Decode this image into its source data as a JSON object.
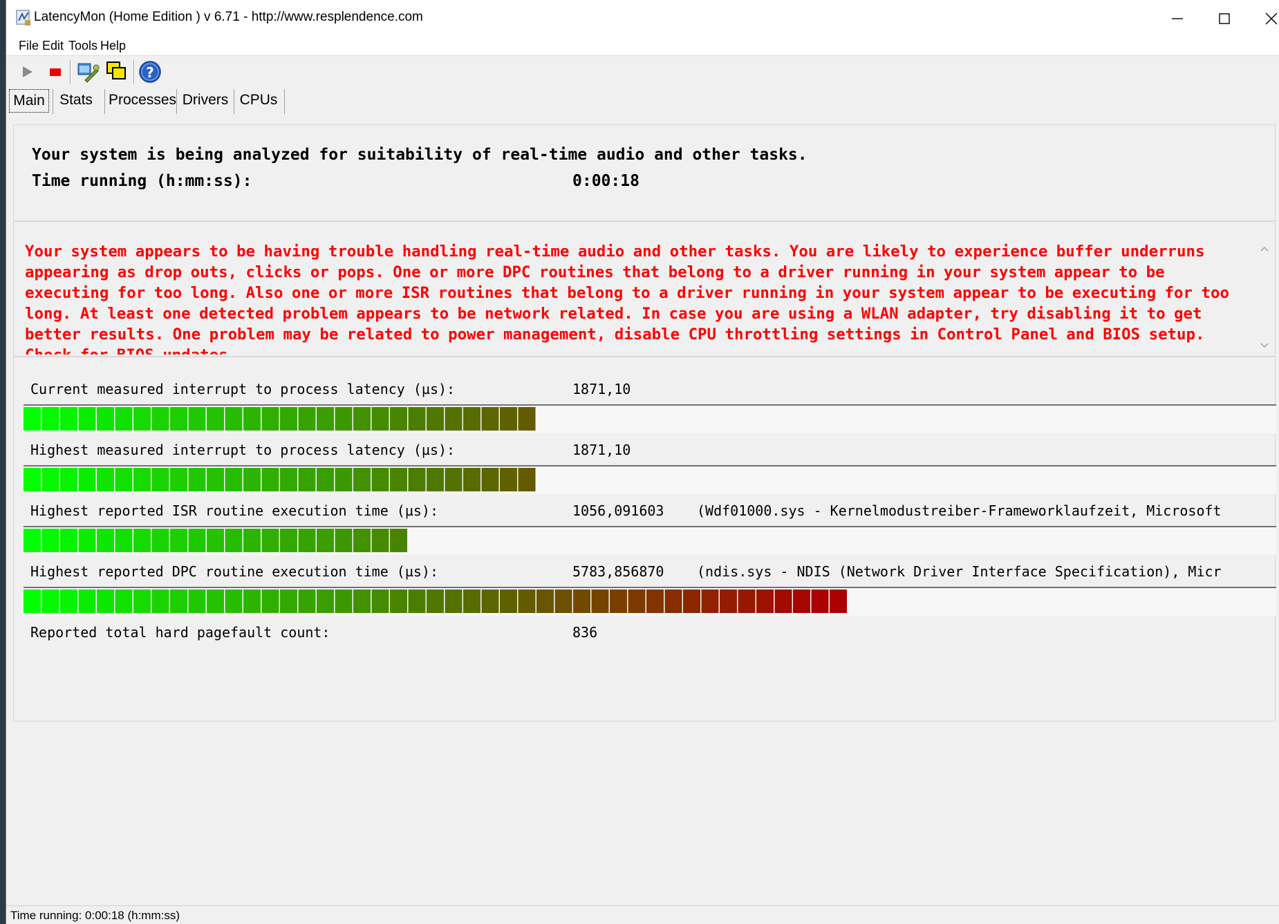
{
  "window": {
    "title": "LatencyMon  (Home Edition )  v 6.71 - http://www.resplendence.com"
  },
  "menu": {
    "items": [
      {
        "label": "File"
      },
      {
        "label": "Edit"
      },
      {
        "label": "Tools"
      },
      {
        "label": "Help"
      }
    ]
  },
  "toolbar": {
    "icons": [
      "play-icon",
      "stop-icon",
      "wrench-icon",
      "windows-icon",
      "help-icon"
    ]
  },
  "tabs": [
    {
      "label": "Main",
      "active": true
    },
    {
      "label": "Stats",
      "active": false
    },
    {
      "label": "Processes",
      "active": false
    },
    {
      "label": "Drivers",
      "active": false
    },
    {
      "label": "CPUs",
      "active": false
    }
  ],
  "summary": {
    "status_line": "Your system is being analyzed for suitability of real-time audio and other tasks.",
    "time_label": "Time running (h:mm:ss):",
    "time_value": "0:00:18"
  },
  "warning": {
    "text": "Your system appears to be having trouble handling real-time audio and other tasks. You are likely to experience buffer underruns appearing as drop outs, clicks or pops. One or more DPC routines that belong to a driver running in your system appear to be executing for too long. Also one or more ISR routines that belong to a driver running in your system appear to be executing for too long. At least one detected problem appears to be network related. In case you are using a WLAN adapter, try disabling it to get better results. One problem may be related to power management, disable CPU throttling settings in Control Panel and BIOS setup. Check for BIOS updates.",
    "color": "#ff0000"
  },
  "metrics": [
    {
      "label": "Current measured interrupt to process latency (µs):",
      "value": "1871,10",
      "extra": "",
      "bar_fraction": 0.415
    },
    {
      "label": "Highest measured interrupt to process latency (µs):",
      "value": "1871,10",
      "extra": "",
      "bar_fraction": 0.415
    },
    {
      "label": "Highest reported ISR routine execution time (µs):",
      "value": "1056,091603",
      "extra": "(Wdf01000.sys - Kernelmodustreiber-Frameworklaufzeit, Microsoft",
      "bar_fraction": 0.308
    },
    {
      "label": "Highest reported DPC routine execution time (µs):",
      "value": "5783,856870",
      "extra": "(ndis.sys - NDIS (Network Driver Interface Specification), Micr",
      "bar_fraction": 0.653
    }
  ],
  "pagefault": {
    "label": "Reported total hard pagefault count:",
    "value": "836"
  },
  "statusbar": {
    "text": "Time running: 0:00:18  (h:mm:ss)"
  },
  "colors": {
    "bar_green": "#00ff00",
    "bar_red": "#aa0000"
  }
}
